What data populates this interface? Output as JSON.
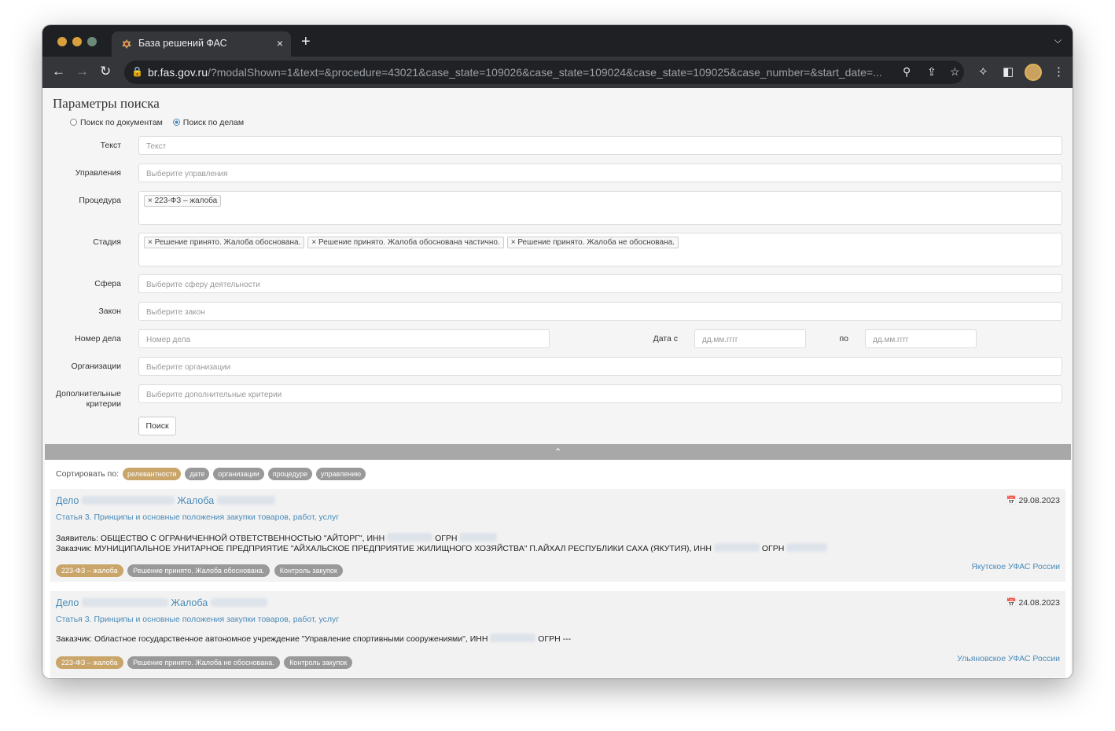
{
  "browser": {
    "tab_title": "База решений ФАС",
    "tab_close": "×",
    "new_tab": "+",
    "url_host": "br.fas.gov.ru",
    "url_rest": "/?modalShown=1&text=&procedure=43021&case_state=109026&case_state=109024&case_state=109025&case_number=&start_date=..."
  },
  "form": {
    "title": "Параметры поиска",
    "radio_docs": "Поиск по документам",
    "radio_cases": "Поиск по делам",
    "text_label": "Текст",
    "text_placeholder": "Текст",
    "departments_label": "Управления",
    "departments_placeholder": "Выберите управления",
    "procedure_label": "Процедура",
    "procedure_chips": [
      "× 223-ФЗ – жалоба"
    ],
    "stage_label": "Стадия",
    "stage_chips": [
      "× Решение принято. Жалоба обоснована.",
      "× Решение принято. Жалоба обоснована частично.",
      "× Решение принято. Жалоба не обоснована."
    ],
    "sphere_label": "Сфера",
    "sphere_placeholder": "Выберите сферу деятельности",
    "law_label": "Закон",
    "law_placeholder": "Выберите закон",
    "case_number_label": "Номер дела",
    "case_number_placeholder": "Номер дела",
    "date_from_label": "Дата с",
    "date_from_placeholder": "дд.мм.гггг",
    "date_to_label": "по",
    "date_to_placeholder": "дд.мм.гггг",
    "orgs_label": "Организации",
    "orgs_placeholder": "Выберите организации",
    "extra_label_1": "Дополнительные",
    "extra_label_2": "критерии",
    "extra_placeholder": "Выберите дополнительные критерии",
    "search_button": "Поиск",
    "collapse_icon": "chevron-up-icon"
  },
  "sort": {
    "label": "Сортировать по:",
    "options": [
      "релевантности",
      "дате",
      "организации",
      "процедуре",
      "управлению"
    ],
    "active": "релевантности"
  },
  "results": [
    {
      "title_prefix": "Дело",
      "title_mid": "Жалоба",
      "date": "29.08.2023",
      "article": "Статья 3. Принципы и основные положения закупки товаров, работ, услуг",
      "applicant": "Заявитель: ОБЩЕСТВО С ОГРАНИЧЕННОЙ ОТВЕТСТВЕННОСТЬЮ \"АЙТОРГ\", ИНН",
      "applicant_ogrn": "ОГРН",
      "customer": "Заказчик: МУНИЦИПАЛЬНОЕ УНИТАРНОЕ ПРЕДПРИЯТИЕ \"АЙХАЛЬСКОЕ ПРЕДПРИЯТИЕ ЖИЛИЩНОГО ХОЗЯЙСТВА\" П.АЙХАЛ РЕСПУБЛИКИ САХА (ЯКУТИЯ), ИНН",
      "customer_ogrn": "ОГРН",
      "tags": [
        "223-ФЗ – жалоба",
        "Решение принято. Жалоба обоснована.",
        "Контроль закупок"
      ],
      "ufas": "Якутское УФАС России"
    },
    {
      "title_prefix": "Дело",
      "title_mid": "Жалоба",
      "date": "24.08.2023",
      "article": "Статья 3. Принципы и основные положения закупки товаров, работ, услуг",
      "customer": "Заказчик: Областное государственное автономное учреждение \"Управление спортивными сооружениями\", ИНН",
      "customer_ogrn": "ОГРН ---",
      "tags": [
        "223-ФЗ – жалоба",
        "Решение принято. Жалоба не обоснована.",
        "Контроль закупок"
      ],
      "ufas": "Ульяновское УФАС России"
    }
  ]
}
